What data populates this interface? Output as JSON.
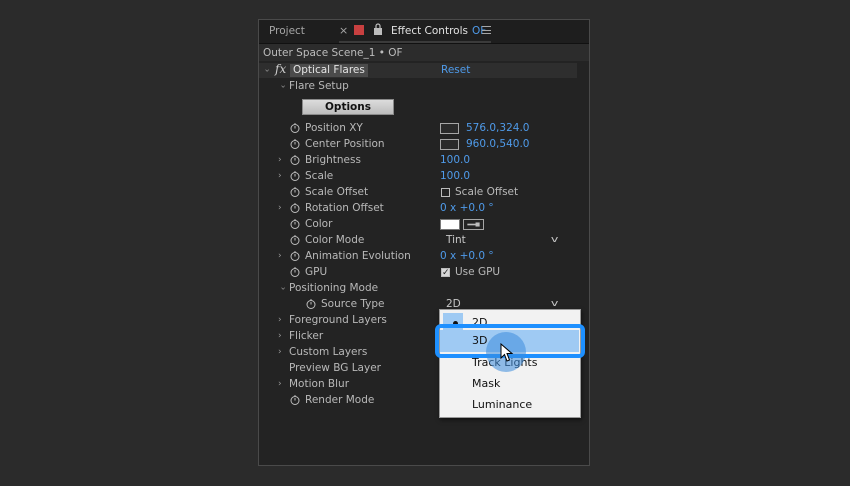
{
  "tabs": {
    "project": "Project",
    "close": "×",
    "effect_controls": "Effect Controls",
    "layer_tag": "OF"
  },
  "header": {
    "path": "Outer Space Scene_1 • OF"
  },
  "effect": {
    "fx": "fx",
    "name": "Optical Flares",
    "reset": "Reset"
  },
  "flare_setup": "Flare Setup",
  "options_button": "Options",
  "params": [
    {
      "label": "Position XY",
      "value": "576.0,324.0"
    },
    {
      "label": "Center Position",
      "value": "960.0,540.0"
    },
    {
      "label": "Brightness",
      "value": "100.0"
    },
    {
      "label": "Scale",
      "value": "100.0"
    },
    {
      "label": "Scale Offset",
      "value": "Scale Offset"
    },
    {
      "label": "Rotation Offset",
      "value": "0 x +0.0 °"
    },
    {
      "label": "Color",
      "value": ""
    },
    {
      "label": "Color Mode",
      "value": "Tint"
    },
    {
      "label": "Animation Evolution",
      "value": "0 x +0.0 °"
    },
    {
      "label": "GPU",
      "value": "Use GPU"
    }
  ],
  "positioning_mode": "Positioning Mode",
  "source_type": {
    "label": "Source Type",
    "value": "2D"
  },
  "groups": [
    "Foreground Layers",
    "Flicker",
    "Custom Layers",
    "Preview BG Layer",
    "Motion Blur",
    "Render Mode"
  ],
  "menu": {
    "items": [
      "2D",
      "3D",
      "Track Lights",
      "Mask",
      "Luminance"
    ],
    "checked": "2D",
    "hovered": "3D"
  },
  "colors": {
    "accent": "#4f9bea",
    "highlight": "#1e90ff",
    "menu_hover": "#9fcaf3"
  }
}
